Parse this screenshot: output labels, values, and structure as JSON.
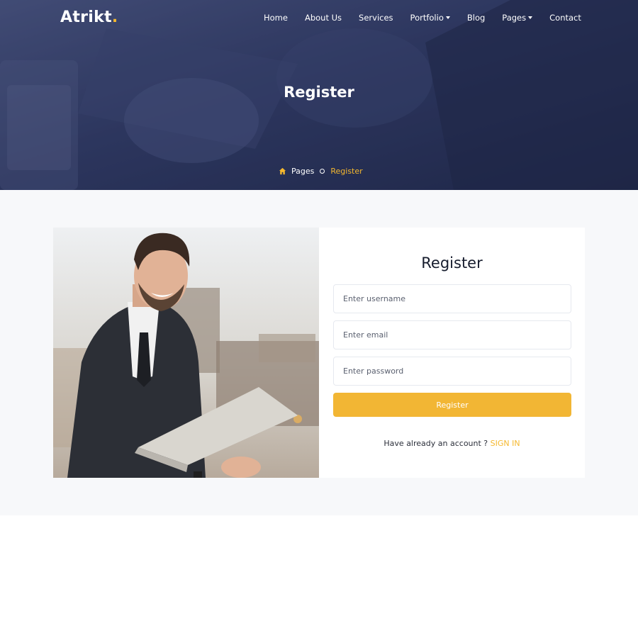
{
  "brand": {
    "name": "Atrikt",
    "dot": ".",
    "accent": "#f5b82e"
  },
  "nav": {
    "items": [
      {
        "label": "Home",
        "dropdown": false
      },
      {
        "label": "About Us",
        "dropdown": false
      },
      {
        "label": "Services",
        "dropdown": false
      },
      {
        "label": "Portfolio",
        "dropdown": true
      },
      {
        "label": "Blog",
        "dropdown": false
      },
      {
        "label": "Pages",
        "dropdown": true
      },
      {
        "label": "Contact",
        "dropdown": false
      }
    ]
  },
  "hero": {
    "title": "Register",
    "breadcrumb": {
      "icon": "home-icon",
      "parent": "Pages",
      "current": "Register"
    }
  },
  "form": {
    "title": "Register",
    "username_placeholder": "Enter username",
    "email_placeholder": "Enter email",
    "password_placeholder": "Enter password",
    "submit_label": "Register",
    "signin_prompt": "Have already an account ?",
    "signin_link": "SIGN IN"
  },
  "colors": {
    "hero_overlay": "#262f52",
    "button": "#f2b634",
    "section_bg": "#f7f8fa"
  }
}
